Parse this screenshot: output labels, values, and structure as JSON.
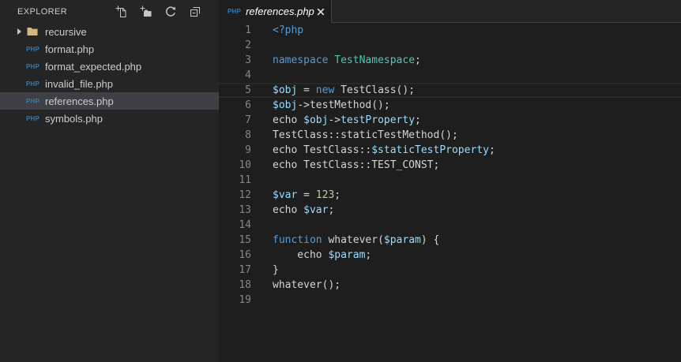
{
  "php_badge": "PHP",
  "sidebar": {
    "title": "EXPLORER",
    "actions": [
      {
        "name": "new-file"
      },
      {
        "name": "new-folder"
      },
      {
        "name": "refresh"
      },
      {
        "name": "collapse-all"
      }
    ],
    "items": [
      {
        "type": "folder",
        "label": "recursive",
        "expanded": false,
        "selected": false
      },
      {
        "type": "php-file",
        "label": "format.php",
        "selected": false
      },
      {
        "type": "php-file",
        "label": "format_expected.php",
        "selected": false
      },
      {
        "type": "php-file",
        "label": "invalid_file.php",
        "selected": false
      },
      {
        "type": "php-file",
        "label": "references.php",
        "selected": true
      },
      {
        "type": "php-file",
        "label": "symbols.php",
        "selected": false
      }
    ]
  },
  "tabbar": {
    "tabs": [
      {
        "label": "references.php",
        "active": true
      }
    ]
  },
  "editor": {
    "current_line": 5,
    "lines": [
      {
        "n": 1,
        "tokens": [
          [
            "kw",
            "<?php"
          ]
        ]
      },
      {
        "n": 2,
        "tokens": []
      },
      {
        "n": 3,
        "tokens": [
          [
            "kw",
            "namespace"
          ],
          [
            "fg",
            " "
          ],
          [
            "cls",
            "TestNamespace"
          ],
          [
            "fg",
            ";"
          ]
        ]
      },
      {
        "n": 4,
        "tokens": []
      },
      {
        "n": 5,
        "tokens": [
          [
            "var",
            "$obj"
          ],
          [
            "fg",
            " = "
          ],
          [
            "kw",
            "new"
          ],
          [
            "fg",
            " TestClass();"
          ]
        ]
      },
      {
        "n": 6,
        "tokens": [
          [
            "var",
            "$obj"
          ],
          [
            "fg",
            "->testMethod();"
          ]
        ]
      },
      {
        "n": 7,
        "tokens": [
          [
            "fg",
            "echo "
          ],
          [
            "var",
            "$obj"
          ],
          [
            "fg",
            "->"
          ],
          [
            "var",
            "testProperty"
          ],
          [
            "fg",
            ";"
          ]
        ]
      },
      {
        "n": 8,
        "tokens": [
          [
            "fg",
            "TestClass::staticTestMethod();"
          ]
        ]
      },
      {
        "n": 9,
        "tokens": [
          [
            "fg",
            "echo TestClass::"
          ],
          [
            "var",
            "$staticTestProperty"
          ],
          [
            "fg",
            ";"
          ]
        ]
      },
      {
        "n": 10,
        "tokens": [
          [
            "fg",
            "echo TestClass::TEST_CONST;"
          ]
        ]
      },
      {
        "n": 11,
        "tokens": []
      },
      {
        "n": 12,
        "tokens": [
          [
            "var",
            "$var"
          ],
          [
            "fg",
            " = "
          ],
          [
            "num",
            "123"
          ],
          [
            "fg",
            ";"
          ]
        ]
      },
      {
        "n": 13,
        "tokens": [
          [
            "fg",
            "echo "
          ],
          [
            "var",
            "$var"
          ],
          [
            "fg",
            ";"
          ]
        ]
      },
      {
        "n": 14,
        "tokens": []
      },
      {
        "n": 15,
        "tokens": [
          [
            "kw",
            "function"
          ],
          [
            "fg",
            " whatever("
          ],
          [
            "var",
            "$param"
          ],
          [
            "fg",
            ") {"
          ]
        ]
      },
      {
        "n": 16,
        "tokens": [
          [
            "fg",
            "    echo "
          ],
          [
            "var",
            "$param"
          ],
          [
            "fg",
            ";"
          ]
        ]
      },
      {
        "n": 17,
        "tokens": [
          [
            "fg",
            "}"
          ]
        ]
      },
      {
        "n": 18,
        "tokens": [
          [
            "fg",
            "whatever();"
          ]
        ]
      },
      {
        "n": 19,
        "tokens": []
      }
    ]
  },
  "colors": {
    "kw": "#569cd6",
    "cls": "#4ec9b0",
    "var": "#9cdcfe",
    "num": "#b5cea8",
    "fg": "#d4d4d4",
    "editor_bg": "#1e1e1e",
    "sidebar_bg": "#252526",
    "selection_bg": "#3f3f46",
    "line_highlight_border": "#282828",
    "tab_border": "#3f3f42",
    "folder_icon": "#d5b682",
    "php_icon": "#2e7cb8"
  }
}
